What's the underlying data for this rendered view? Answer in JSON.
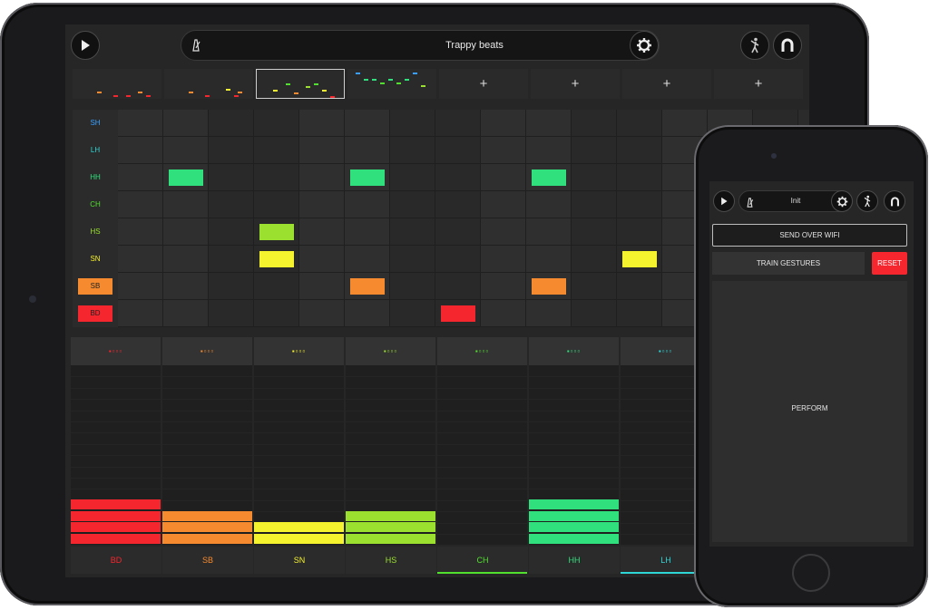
{
  "ipad": {
    "project_title": "Trappy beats",
    "patterns": [
      {
        "kind": "thumb"
      },
      {
        "kind": "thumb"
      },
      {
        "kind": "thumb",
        "selected": true
      },
      {
        "kind": "thumb"
      },
      {
        "kind": "add",
        "label": "+"
      },
      {
        "kind": "add",
        "label": "+"
      },
      {
        "kind": "add",
        "label": "+"
      },
      {
        "kind": "add",
        "label": "+"
      }
    ],
    "tracks": [
      {
        "label": "SH",
        "color": "#3aa0ff"
      },
      {
        "label": "LH",
        "color": "#2fd6d6"
      },
      {
        "label": "HH",
        "color": "#2fe07c"
      },
      {
        "label": "CH",
        "color": "#52e02f"
      },
      {
        "label": "HS",
        "color": "#9be02f"
      },
      {
        "label": "SN",
        "color": "#f5f22e"
      },
      {
        "label": "SB",
        "color": "#f58a2e"
      },
      {
        "label": "BD",
        "color": "#f5262e"
      }
    ],
    "steps_on": [
      {
        "row": 2,
        "col": 1
      },
      {
        "row": 2,
        "col": 3
      },
      {
        "row": 2,
        "col": 5
      },
      {
        "row": 4,
        "col": 2
      },
      {
        "row": 4,
        "col": 7
      },
      {
        "row": 5,
        "col": 2
      },
      {
        "row": 5,
        "col": 6
      },
      {
        "row": 6,
        "col": 3
      },
      {
        "row": 6,
        "col": 5
      },
      {
        "row": 7,
        "col": 4
      },
      {
        "row": 7,
        "col": 7
      }
    ],
    "mixer": [
      {
        "label": "BD",
        "color": "#f5262e",
        "level": 0.26
      },
      {
        "label": "SB",
        "color": "#f58a2e",
        "level": 0.19
      },
      {
        "label": "SN",
        "color": "#f5f22e",
        "level": 0.13
      },
      {
        "label": "HS",
        "color": "#9be02f",
        "level": 0.19
      },
      {
        "label": "CH",
        "color": "#52e02f",
        "level": 0.0,
        "active": true
      },
      {
        "label": "HH",
        "color": "#2fe07c",
        "level": 0.26
      },
      {
        "label": "LH",
        "color": "#2fd6d6",
        "level": 0.0,
        "active": true
      }
    ],
    "mixer_indicator": "▪▫▫▫"
  },
  "iphone": {
    "project_title": "Init",
    "send_label": "SEND OVER WIFI",
    "train_label": "TRAIN GESTURES",
    "reset_label": "RESET",
    "perform_label": "PERFORM"
  },
  "colors": {
    "reset": "#f5262e"
  }
}
